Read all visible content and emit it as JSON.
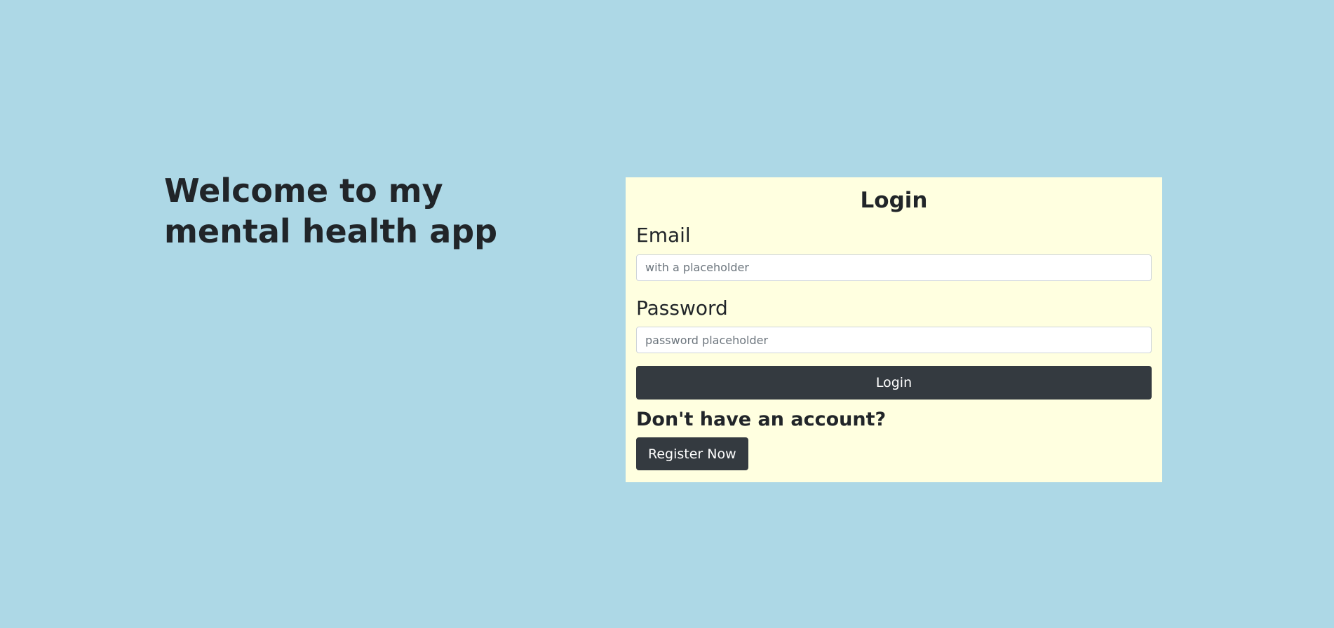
{
  "hero": {
    "heading": "Welcome to my mental health app"
  },
  "login": {
    "title": "Login",
    "email_label": "Email",
    "email_placeholder": "with a placeholder",
    "email_value": "",
    "password_label": "Password",
    "password_placeholder": "password placeholder",
    "password_value": "",
    "submit_label": "Login"
  },
  "register": {
    "question": "Don't have an account?",
    "button_label": "Register Now"
  },
  "colors": {
    "page_background": "#add8e6",
    "card_background": "#ffffe0",
    "button_background": "#343a40"
  }
}
